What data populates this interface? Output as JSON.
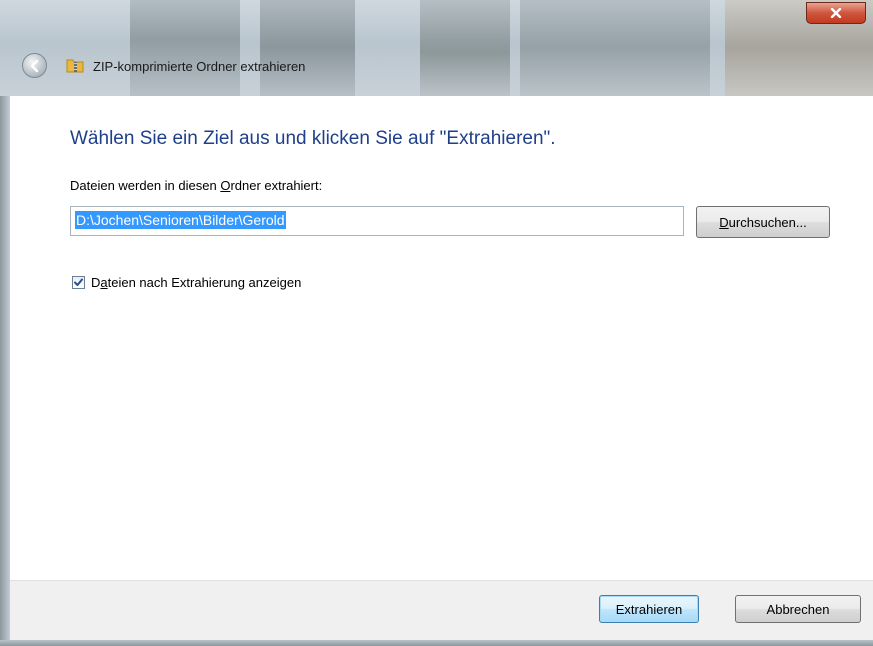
{
  "window": {
    "title": "ZIP-komprimierte Ordner extrahieren",
    "close_glyph": "x"
  },
  "main": {
    "heading": "Wählen Sie ein Ziel aus und klicken Sie auf \"Extrahieren\".",
    "folder_label_pre": "Dateien werden in diesen ",
    "folder_label_accel": "O",
    "folder_label_post": "rdner extrahiert:",
    "path_value": "D:\\Jochen\\Senioren\\Bilder\\Gerold",
    "browse": {
      "accel": "D",
      "rest": "urchsuchen..."
    },
    "show_files": {
      "checked": true,
      "pre": "D",
      "accel": "a",
      "post": "teien nach Extrahierung anzeigen"
    }
  },
  "footer": {
    "extract_label": "Extrahieren",
    "cancel_label": "Abbrechen"
  },
  "icons": [
    "back-arrow-icon",
    "zip-folder-icon",
    "close-icon",
    "checkmark-icon"
  ]
}
